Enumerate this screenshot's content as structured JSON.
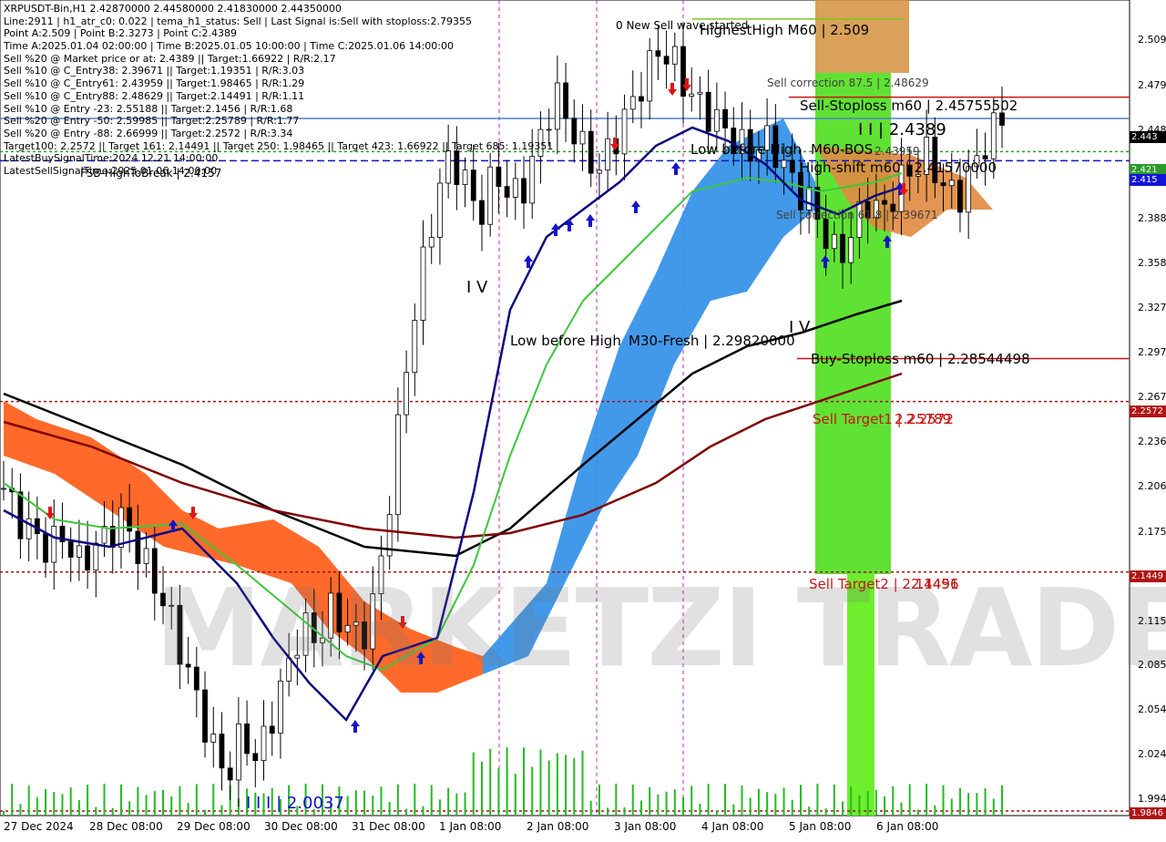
{
  "header": {
    "lines": [
      "XRPUSDT-Bin,H1  2.42870000 2.44580000 2.41830000 2.44350000",
      "Line:2911 | h1_atr_c0: 0.022 | tema_h1_status: Sell | Last Signal is:Sell with stoploss:2.79355",
      "Point A:2.509 | Point B:2.3273 | Point C:2.4389",
      "Time A:2025.01.04 02:00:00 | Time B:2025.01.05 10:00:00 | Time C:2025.01.06 14:00:00",
      "Sell %20 @ Market price or at: 2.4389 || Target:1.66922 | R/R:2.17",
      "Sell %10 @ C_Entry38: 2.39671 || Target:1.19351 | R/R:3.03",
      "Sell %10 @ C_Entry61: 2.43959 || Target:1.98465 | R/R:1.29",
      "Sell %10 @ C_Entry88: 2.48629 || Target:2.14491 | R/R:1.11",
      "Sell %10 @ Entry -23: 2.55188 || Target:2.1456 | R/R:1.68",
      "Sell %20 @ Entry -50: 2.59985 || Target:2.25789 | R/R:1.77",
      "Sell %20 @ Entry -88: 2.66999 || Target:2.2572 | R/R:3.34",
      "Target100: 2.2572 || Target 161: 2.14491 || Target 250: 1.98465 || Target 423: 1.66922 || Target 685: 1.19351",
      "LatestBuySignalTime:2024.12.21 14:00:00",
      "LatestSellSignalTime:2025.01.06 14:00:00"
    ]
  },
  "annotations": {
    "fsb": "FSB-HighToBreak | 2.4157",
    "new_sell_wave": "0 New Sell wave started",
    "highest_high": "HighestHigh   M60 | 2.509",
    "sell_correction_875": "Sell correction 87.5 | 2.48629",
    "sell_stoploss": "Sell-Stoploss m60 | 2.45755502",
    "point_c": "I I | 2.4389",
    "low_before_high_top": "Low before High",
    "m60_bos": "M60-BOS",
    "bos_value": "2.43959",
    "high_shift": "High-shift m60 | 2.41570000",
    "sell_correction_low": "Sell correction 61.8 | 2.39671",
    "wave_iv": "I V",
    "wave_v": "I V",
    "low_before_high_mid": "Low before High",
    "m30_fresh": "M30-Fresh | 2.29820000",
    "buy_stoploss": "Buy-Stoploss m60 | 2.28544498",
    "sell_target_1": "Sell Target1 | 2.2572",
    "sell_target_1b": "2.25789",
    "sell_target_2": "Sell Target2 | 2.14491",
    "sell_target_2b": "2.1456",
    "point_iii": "I I I | 2.0037"
  },
  "price_tags": {
    "current": "2.443",
    "high_shift": "2.421",
    "fsb": "2.415",
    "target1": "2.2572",
    "target2": "2.1449",
    "bottom": "1.9846"
  },
  "watermark": "MARKETZI TRADE",
  "colors": {
    "cloud_bull": "#2e8ee8",
    "cloud_bear": "#ff5a14",
    "cloud_bear_dim": "#e08a40",
    "ma_navy": "#0a0a80",
    "ma_green": "#3cc83c",
    "ma_black": "#000000",
    "ma_maroon": "#800000",
    "zone_green": "#44dd11",
    "zone_orange": "#d2913c",
    "stop_red": "#c81414",
    "signal_blue": "#1414c8",
    "signal_red": "#e01414"
  },
  "chart_data": {
    "type": "candlestick",
    "symbol": "XRPUSDT-Bin",
    "timeframe": "H1",
    "ylim": [
      1.9846,
      2.5215
    ],
    "y_ticks": [
      2.509,
      2.479,
      2.448,
      2.418,
      2.388,
      2.358,
      2.327,
      2.297,
      2.267,
      2.236,
      2.206,
      2.175,
      2.145,
      2.115,
      2.085,
      2.054,
      2.024,
      1.994
    ],
    "x_ticks": [
      "27 Dec 2024",
      "28 Dec 08:00",
      "29 Dec 08:00",
      "30 Dec 08:00",
      "31 Dec 08:00",
      "1 Jan 08:00",
      "2 Jan 08:00",
      "3 Jan 08:00",
      "4 Jan 08:00",
      "5 Jan 08:00",
      "6 Jan 08:00"
    ],
    "levels": [
      {
        "value": 2.509,
        "kind": "highest_high"
      },
      {
        "value": 2.45755502,
        "kind": "sell_stoploss"
      },
      {
        "value": 2.4435,
        "kind": "current_price"
      },
      {
        "value": 2.4157,
        "kind": "fsb_high_to_break"
      },
      {
        "value": 2.4157,
        "kind": "high_shift"
      },
      {
        "value": 2.2982,
        "kind": "m30_fresh"
      },
      {
        "value": 2.28544498,
        "kind": "buy_stoploss"
      },
      {
        "value": 2.2572,
        "kind": "sell_target_1"
      },
      {
        "value": 2.14491,
        "kind": "sell_target_2"
      },
      {
        "value": 1.9846,
        "kind": "bottom"
      }
    ],
    "points": {
      "A": 2.509,
      "B": 2.3273,
      "C": 2.4389,
      "III": 2.0037
    },
    "ohlc_last": {
      "open": 2.4287,
      "high": 2.4458,
      "low": 2.4183,
      "close": 2.4435
    },
    "close_path": [
      [
        0,
        2.2
      ],
      [
        1,
        2.18
      ],
      [
        2,
        2.17
      ],
      [
        3,
        2.16
      ],
      [
        4,
        2.17
      ],
      [
        5,
        2.15
      ],
      [
        6,
        2.16
      ],
      [
        7,
        2.17
      ],
      [
        8,
        2.18
      ],
      [
        9,
        2.16
      ],
      [
        10,
        2.14
      ],
      [
        11,
        2.12
      ],
      [
        12,
        2.09
      ],
      [
        13,
        2.06
      ],
      [
        14,
        2.03
      ],
      [
        15,
        2.01
      ],
      [
        16,
        2.04
      ],
      [
        17,
        2.02
      ],
      [
        18,
        2.05
      ],
      [
        19,
        2.08
      ],
      [
        20,
        2.11
      ],
      [
        21,
        2.1
      ],
      [
        22,
        2.12
      ],
      [
        23,
        2.11
      ],
      [
        24,
        2.1
      ],
      [
        25,
        2.13
      ],
      [
        26,
        2.2
      ],
      [
        27,
        2.28
      ],
      [
        28,
        2.34
      ],
      [
        29,
        2.39
      ],
      [
        30,
        2.42
      ],
      [
        31,
        2.4
      ],
      [
        32,
        2.38
      ],
      [
        33,
        2.41
      ],
      [
        34,
        2.39
      ],
      [
        35,
        2.4
      ],
      [
        36,
        2.43
      ],
      [
        37,
        2.46
      ],
      [
        38,
        2.44
      ],
      [
        39,
        2.42
      ],
      [
        40,
        2.41
      ],
      [
        41,
        2.43
      ],
      [
        42,
        2.45
      ],
      [
        43,
        2.47
      ],
      [
        44,
        2.49
      ],
      [
        45,
        2.48
      ],
      [
        46,
        2.46
      ],
      [
        47,
        2.45
      ],
      [
        48,
        2.44
      ],
      [
        49,
        2.43
      ],
      [
        50,
        2.42
      ],
      [
        51,
        2.43
      ],
      [
        52,
        2.42
      ],
      [
        53,
        2.4
      ],
      [
        54,
        2.39
      ],
      [
        55,
        2.37
      ],
      [
        56,
        2.35
      ],
      [
        57,
        2.37
      ],
      [
        58,
        2.39
      ],
      [
        59,
        2.38
      ],
      [
        60,
        2.4
      ],
      [
        61,
        2.41
      ],
      [
        62,
        2.42
      ],
      [
        63,
        2.4
      ],
      [
        64,
        2.39
      ],
      [
        65,
        2.41
      ],
      [
        66,
        2.43
      ],
      [
        67,
        2.4435
      ]
    ]
  }
}
